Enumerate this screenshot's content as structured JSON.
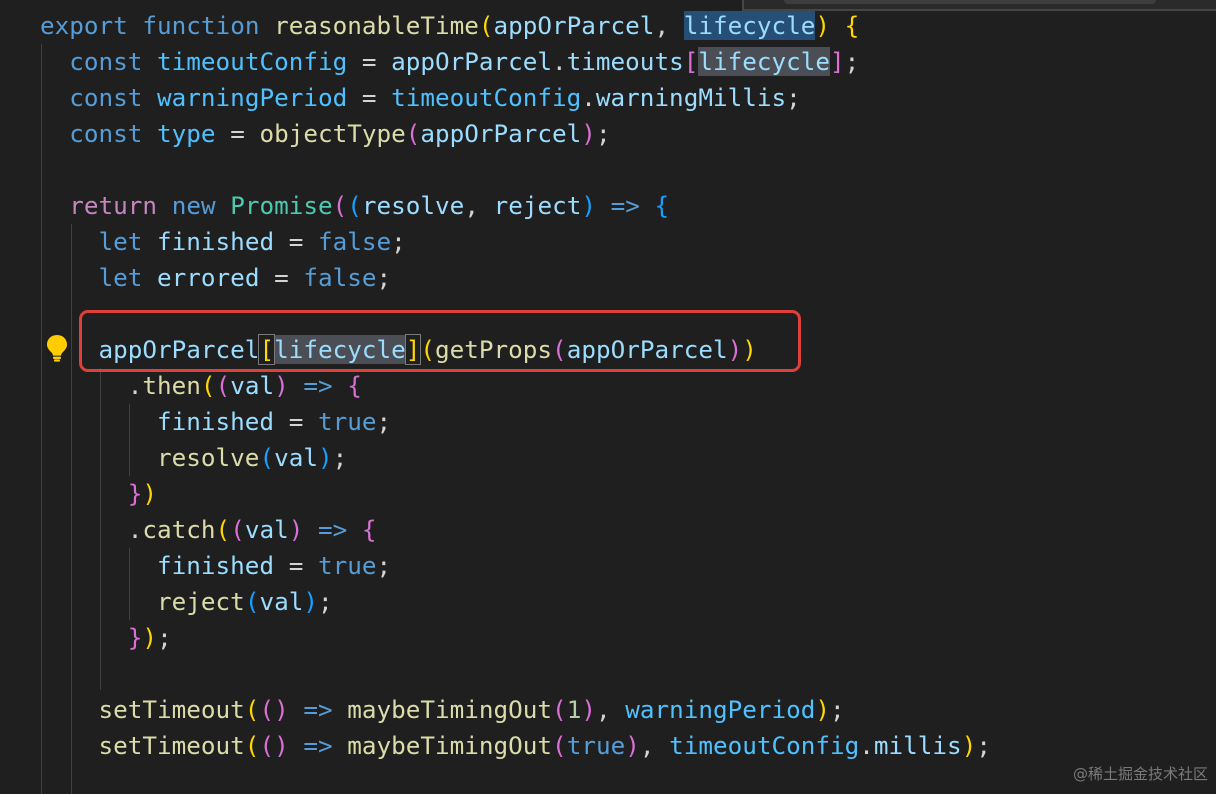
{
  "editor": {
    "theme": {
      "background": "#1f1f1f",
      "keyword": "#569cd6",
      "control": "#c586c0",
      "function": "#dcdcaa",
      "variable": "#9cdcfe",
      "constant": "#4fc1ff",
      "class": "#4ec9b0",
      "number": "#b5cea8",
      "highlight_box": "#e0403a"
    },
    "lines": [
      [
        [
          "kw",
          "export"
        ],
        [
          "plain",
          " "
        ],
        [
          "kw",
          "function"
        ],
        [
          "plain",
          " "
        ],
        [
          "fn",
          "reasonableTime"
        ],
        [
          "b1",
          "("
        ],
        [
          "var",
          "appOrParcel"
        ],
        [
          "plain",
          ", "
        ],
        [
          "var",
          "lifecycle",
          "sel-word"
        ],
        [
          "b1",
          ")"
        ],
        [
          "plain",
          " "
        ],
        [
          "b1",
          "{"
        ]
      ],
      [
        [
          "plain",
          "  "
        ],
        [
          "kw",
          "const"
        ],
        [
          "plain",
          " "
        ],
        [
          "cst",
          "timeoutConfig"
        ],
        [
          "plain",
          " = "
        ],
        [
          "var",
          "appOrParcel"
        ],
        [
          "plain",
          "."
        ],
        [
          "var",
          "timeouts"
        ],
        [
          "b2",
          "["
        ],
        [
          "var",
          "lifecycle",
          "sel-occ"
        ],
        [
          "b2",
          "]"
        ],
        [
          "plain",
          ";"
        ]
      ],
      [
        [
          "plain",
          "  "
        ],
        [
          "kw",
          "const"
        ],
        [
          "plain",
          " "
        ],
        [
          "cst",
          "warningPeriod"
        ],
        [
          "plain",
          " = "
        ],
        [
          "cst",
          "timeoutConfig"
        ],
        [
          "plain",
          "."
        ],
        [
          "var",
          "warningMillis"
        ],
        [
          "plain",
          ";"
        ]
      ],
      [
        [
          "plain",
          "  "
        ],
        [
          "kw",
          "const"
        ],
        [
          "plain",
          " "
        ],
        [
          "cst",
          "type"
        ],
        [
          "plain",
          " = "
        ],
        [
          "fn",
          "objectType"
        ],
        [
          "b2",
          "("
        ],
        [
          "var",
          "appOrParcel"
        ],
        [
          "b2",
          ")"
        ],
        [
          "plain",
          ";"
        ]
      ],
      [],
      [
        [
          "plain",
          "  "
        ],
        [
          "ctl",
          "return"
        ],
        [
          "plain",
          " "
        ],
        [
          "kw",
          "new"
        ],
        [
          "plain",
          " "
        ],
        [
          "cls",
          "Promise"
        ],
        [
          "b2",
          "("
        ],
        [
          "b3",
          "("
        ],
        [
          "var",
          "resolve"
        ],
        [
          "plain",
          ", "
        ],
        [
          "var",
          "reject"
        ],
        [
          "b3",
          ")"
        ],
        [
          "plain",
          " "
        ],
        [
          "kw",
          "=>"
        ],
        [
          "plain",
          " "
        ],
        [
          "b3",
          "{"
        ]
      ],
      [
        [
          "plain",
          "    "
        ],
        [
          "kw",
          "let"
        ],
        [
          "plain",
          " "
        ],
        [
          "var",
          "finished"
        ],
        [
          "plain",
          " = "
        ],
        [
          "kw",
          "false"
        ],
        [
          "plain",
          ";"
        ]
      ],
      [
        [
          "plain",
          "    "
        ],
        [
          "kw",
          "let"
        ],
        [
          "plain",
          " "
        ],
        [
          "var",
          "errored"
        ],
        [
          "plain",
          " = "
        ],
        [
          "kw",
          "false"
        ],
        [
          "plain",
          ";"
        ]
      ],
      [],
      [
        [
          "plain",
          "    "
        ],
        [
          "var",
          "appOrParcel"
        ],
        [
          "b1",
          "[",
          "bracket-match"
        ],
        [
          "var",
          "lifecycle",
          "sel-occ"
        ],
        [
          "b1",
          "]",
          "bracket-match"
        ],
        [
          "b1",
          "("
        ],
        [
          "fn",
          "getProps"
        ],
        [
          "b2",
          "("
        ],
        [
          "var",
          "appOrParcel"
        ],
        [
          "b2",
          ")"
        ],
        [
          "b1",
          ")"
        ]
      ],
      [
        [
          "plain",
          "      ."
        ],
        [
          "fn",
          "then"
        ],
        [
          "b1",
          "("
        ],
        [
          "b2",
          "("
        ],
        [
          "var",
          "val"
        ],
        [
          "b2",
          ")"
        ],
        [
          "plain",
          " "
        ],
        [
          "kw",
          "=>"
        ],
        [
          "plain",
          " "
        ],
        [
          "b2",
          "{"
        ]
      ],
      [
        [
          "plain",
          "        "
        ],
        [
          "var",
          "finished"
        ],
        [
          "plain",
          " = "
        ],
        [
          "kw",
          "true"
        ],
        [
          "plain",
          ";"
        ]
      ],
      [
        [
          "plain",
          "        "
        ],
        [
          "fn",
          "resolve"
        ],
        [
          "b3",
          "("
        ],
        [
          "var",
          "val"
        ],
        [
          "b3",
          ")"
        ],
        [
          "plain",
          ";"
        ]
      ],
      [
        [
          "plain",
          "      "
        ],
        [
          "b2",
          "}"
        ],
        [
          "b1",
          ")"
        ]
      ],
      [
        [
          "plain",
          "      ."
        ],
        [
          "fn",
          "catch"
        ],
        [
          "b1",
          "("
        ],
        [
          "b2",
          "("
        ],
        [
          "var",
          "val"
        ],
        [
          "b2",
          ")"
        ],
        [
          "plain",
          " "
        ],
        [
          "kw",
          "=>"
        ],
        [
          "plain",
          " "
        ],
        [
          "b2",
          "{"
        ]
      ],
      [
        [
          "plain",
          "        "
        ],
        [
          "var",
          "finished"
        ],
        [
          "plain",
          " = "
        ],
        [
          "kw",
          "true"
        ],
        [
          "plain",
          ";"
        ]
      ],
      [
        [
          "plain",
          "        "
        ],
        [
          "fn",
          "reject"
        ],
        [
          "b3",
          "("
        ],
        [
          "var",
          "val"
        ],
        [
          "b3",
          ")"
        ],
        [
          "plain",
          ";"
        ]
      ],
      [
        [
          "plain",
          "      "
        ],
        [
          "b2",
          "}"
        ],
        [
          "b1",
          ")"
        ],
        [
          "plain",
          ";"
        ]
      ],
      [],
      [
        [
          "plain",
          "    "
        ],
        [
          "fn",
          "setTimeout"
        ],
        [
          "b1",
          "("
        ],
        [
          "b2",
          "()"
        ],
        [
          "plain",
          " "
        ],
        [
          "kw",
          "=>"
        ],
        [
          "plain",
          " "
        ],
        [
          "fn",
          "maybeTimingOut"
        ],
        [
          "b2",
          "("
        ],
        [
          "num",
          "1"
        ],
        [
          "b2",
          ")"
        ],
        [
          "plain",
          ", "
        ],
        [
          "cst",
          "warningPeriod"
        ],
        [
          "b1",
          ")"
        ],
        [
          "plain",
          ";"
        ]
      ],
      [
        [
          "plain",
          "    "
        ],
        [
          "fn",
          "setTimeout"
        ],
        [
          "b1",
          "("
        ],
        [
          "b2",
          "()"
        ],
        [
          "plain",
          " "
        ],
        [
          "kw",
          "=>"
        ],
        [
          "plain",
          " "
        ],
        [
          "fn",
          "maybeTimingOut"
        ],
        [
          "b2",
          "("
        ],
        [
          "kw",
          "true"
        ],
        [
          "b2",
          ")"
        ],
        [
          "plain",
          ", "
        ],
        [
          "cst",
          "timeoutConfig"
        ],
        [
          "plain",
          "."
        ],
        [
          "var",
          "millis"
        ],
        [
          "b1",
          ")"
        ],
        [
          "plain",
          ";"
        ]
      ]
    ]
  },
  "lightbulb": {
    "icon": "lightbulb-icon",
    "color": "#ffcc00"
  },
  "watermark": "@稀土掘金技术社区"
}
